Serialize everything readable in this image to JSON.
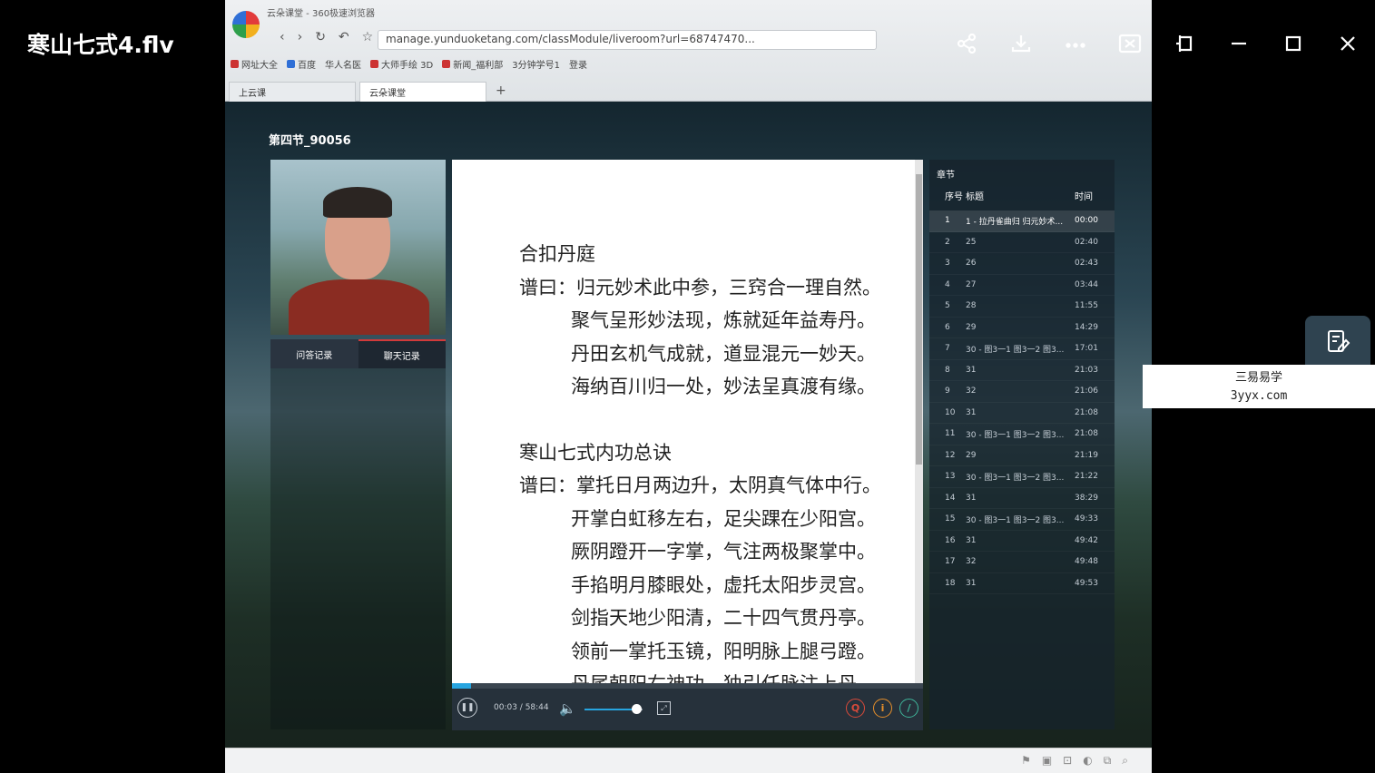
{
  "player": {
    "title": "寒山七式4.flv",
    "controls": [
      "share-icon",
      "download-icon",
      "more-icon",
      "cast-icon",
      "pin-icon",
      "minimize-icon",
      "maximize-icon",
      "close-icon"
    ]
  },
  "browser": {
    "window_title": "云朵课堂 - 360极速浏览器",
    "address": "manage.yunduoketang.com/classModule/liveroom?url=68747470...",
    "bookmarks": [
      "网址大全",
      "百度",
      "华人名医",
      "大师手绘 3D",
      "新闻_福利部",
      "3分钟学号1",
      "登录"
    ],
    "tabs": [
      "上云课",
      "云朵课堂"
    ],
    "new_tab": "+"
  },
  "lesson": {
    "section_title": "第四节_90056",
    "cam_tabs": [
      "问答记录",
      "聊天记录"
    ],
    "doc_lines": [
      {
        "text": "合扣丹庭",
        "type": "head"
      },
      {
        "text": "谱曰：归元妙术此中参，三窍合一理自然。",
        "type": "first"
      },
      {
        "text": "聚气呈形妙法现，炼就延年益寿丹。",
        "type": "indent"
      },
      {
        "text": "丹田玄机气成就，道显混元一妙天。",
        "type": "indent"
      },
      {
        "text": "海纳百川归一处，妙法呈真渡有缘。",
        "type": "indent"
      },
      {
        "text": "",
        "type": "gap"
      },
      {
        "text": "寒山七式内功总诀",
        "type": "head"
      },
      {
        "text": "谱曰：掌托日月两边升，太阴真气体中行。",
        "type": "first"
      },
      {
        "text": "开掌白虹移左右，足尖踝在少阳宫。",
        "type": "indent"
      },
      {
        "text": "厥阴蹬开一字掌，气注两极聚掌中。",
        "type": "indent"
      },
      {
        "text": "手掐明月膝眼处，虚托太阳步灵宫。",
        "type": "indent"
      },
      {
        "text": "剑指天地少阳清，二十四气贯丹亭。",
        "type": "indent"
      },
      {
        "text": "领前一掌托玉镜，阳明脉上腿弓蹬。",
        "type": "indent"
      },
      {
        "text": "丹尾朝阳右神功，独引任脉注上丹。",
        "type": "indent"
      }
    ],
    "player": {
      "time": "00:03 / 58:44",
      "progress": 0.04,
      "volume": 0.85,
      "actions": [
        "Q",
        "i",
        "/"
      ]
    },
    "chapters": {
      "title": "章节",
      "headers": [
        "序号",
        "标题",
        "时间"
      ],
      "rows": [
        {
          "num": "1",
          "title": "1 - 拉丹雀曲归 归元妙术...",
          "time": "00:00"
        },
        {
          "num": "2",
          "title": "25",
          "time": "02:40"
        },
        {
          "num": "3",
          "title": "26",
          "time": "02:43"
        },
        {
          "num": "4",
          "title": "27",
          "time": "03:44"
        },
        {
          "num": "5",
          "title": "28",
          "time": "11:55"
        },
        {
          "num": "6",
          "title": "29",
          "time": "14:29"
        },
        {
          "num": "7",
          "title": "30 - 图3一1 图3一2 图3...",
          "time": "17:01"
        },
        {
          "num": "8",
          "title": "31",
          "time": "21:03"
        },
        {
          "num": "9",
          "title": "32",
          "time": "21:06"
        },
        {
          "num": "10",
          "title": "31",
          "time": "21:08"
        },
        {
          "num": "11",
          "title": "30 - 图3一1 图3一2 图3...",
          "time": "21:08"
        },
        {
          "num": "12",
          "title": "29",
          "time": "21:19"
        },
        {
          "num": "13",
          "title": "30 - 图3一1 图3一2 图3...",
          "time": "21:22"
        },
        {
          "num": "14",
          "title": "31",
          "time": "38:29"
        },
        {
          "num": "15",
          "title": "30 - 图3一1 图3一2 图3...",
          "time": "49:33"
        },
        {
          "num": "16",
          "title": "31",
          "time": "49:42"
        },
        {
          "num": "17",
          "title": "32",
          "time": "49:48"
        },
        {
          "num": "18",
          "title": "31",
          "time": "49:53"
        }
      ]
    }
  },
  "watermark": {
    "line1": "三易易学",
    "line2": "3yyx.com"
  }
}
